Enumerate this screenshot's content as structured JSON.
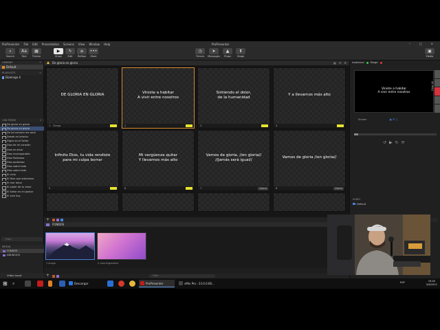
{
  "menubar": {
    "items": [
      "ProPresenter",
      "File",
      "Edit",
      "Presentation",
      "Screens",
      "View",
      "Window",
      "Help"
    ],
    "title": "ProPresenter"
  },
  "toolbar": {
    "left": [
      {
        "label": "Search",
        "icon": "search-icon"
      },
      {
        "label": "Text",
        "icon": "text-icon"
      },
      {
        "label": "Theme",
        "icon": "theme-icon"
      }
    ],
    "center": [
      {
        "label": "Show",
        "icon": "show-icon"
      },
      {
        "label": "Edit",
        "icon": "edit-icon"
      },
      {
        "label": "Reflow",
        "icon": "reflow-icon"
      },
      {
        "label": "More",
        "icon": "more-icon"
      }
    ],
    "right": [
      {
        "label": "Timers",
        "icon": "timer-icon"
      },
      {
        "label": "Messages",
        "icon": "message-icon"
      },
      {
        "label": "Props",
        "icon": "props-icon"
      },
      {
        "label": "Stage",
        "icon": "stage-icon"
      }
    ],
    "media": {
      "label": "Media",
      "icon": "media-icon"
    }
  },
  "library": {
    "header": "LIBRARY",
    "default_label": "Default",
    "playlists_header": "PLAYLISTS",
    "playlist_item": "Domingo 4",
    "items_count": "158 ITEMS",
    "presentations": [
      "De gloria en gloria",
      "De gloria en gloria",
      "De tal manera me amó",
      "Desde mi interior",
      "Digno es el Señor",
      "Dios de mi corazón",
      "Dios es amor",
      "Dios incomparable",
      "Dios Poderoso",
      "Dios poderoso",
      "Dios sobre todo",
      "Dios sobre todo",
      "El cielo",
      "El Dios que adoramos",
      "El mar amor",
      "El poder de tu amor",
      "El Señor es mi pastor",
      "El vive hoy"
    ],
    "filter_placeholder": "Filter",
    "media_header": "MEDIA",
    "media_items": [
      "FONDOS",
      "ANUNCIOS"
    ],
    "video_input": "Video Input"
  },
  "presentation": {
    "title": "De gloria en gloria",
    "slides": [
      {
        "num": "1",
        "label": "Group",
        "text": "DE GLORIA EN GLORIA",
        "chip": true,
        "active": false
      },
      {
        "num": "2",
        "label": "",
        "text": "Viniste a habitar\nA vivir entre nosotros",
        "chip": true,
        "active": true
      },
      {
        "num": "3",
        "label": "",
        "text": "Sintiendo el dolor,\nde la humanidad",
        "chip": true,
        "active": false
      },
      {
        "num": "4",
        "label": "",
        "text": "Y a llevarnos más alto",
        "chip": true,
        "active": false
      },
      {
        "num": "5",
        "label": "",
        "text": "Infinito Dios, tu vida rendiste\npara mi culpa borrar",
        "chip": true,
        "active": false
      },
      {
        "num": "6",
        "label": "",
        "text": "Mi vergüenza quitar\nY llevarnos más alto",
        "chip": true,
        "active": false
      },
      {
        "num": "7",
        "label": "",
        "text": "Vamos de gloria, //en gloria//\n//Jamás será igual//",
        "tag": "Chorus",
        "active": false
      },
      {
        "num": "8",
        "label": "",
        "text": "Vamos de gloria //en gloria//",
        "tag": "Chorus",
        "active": false
      },
      {
        "num": "",
        "label": "",
        "text": "",
        "active": false
      },
      {
        "num": "",
        "label": "",
        "text": "",
        "active": false
      },
      {
        "num": "",
        "label": "",
        "text": "",
        "active": false
      },
      {
        "num": "",
        "label": "",
        "text": "",
        "active": false
      }
    ]
  },
  "media": {
    "group": "FONDOS",
    "thumbs": [
      {
        "caption": "1 image"
      },
      {
        "caption": "2 colorfulgradient"
      }
    ],
    "filter_placeholder": "Filter"
  },
  "right_panel": {
    "audience_label": "Audience",
    "stage_label": "Stage",
    "preview_text": "Viniste a habitar\nA vivir entre nosotros",
    "clear_all": "Clear All",
    "screen_label": "Screen",
    "group_header": "AUDIO",
    "group_item": "Default",
    "items_count": "0 ITEMS"
  },
  "taskbar": {
    "tasks": [
      {
        "label": "Descargar",
        "icon": "download-icon"
      },
      {
        "label": "ProPresenter",
        "icon": "propresenter-icon"
      },
      {
        "label": "vMix Pro - 23.0.0.66...",
        "icon": "vmix-icon"
      }
    ],
    "time": "16:40",
    "date": "5/6/2021",
    "lang": "ESP"
  },
  "colors": {
    "accent_orange": "#d88a2c",
    "chip_yellow": "#e7e42f",
    "selection_blue": "#3a4f73",
    "clear_red": "#d8323c"
  }
}
